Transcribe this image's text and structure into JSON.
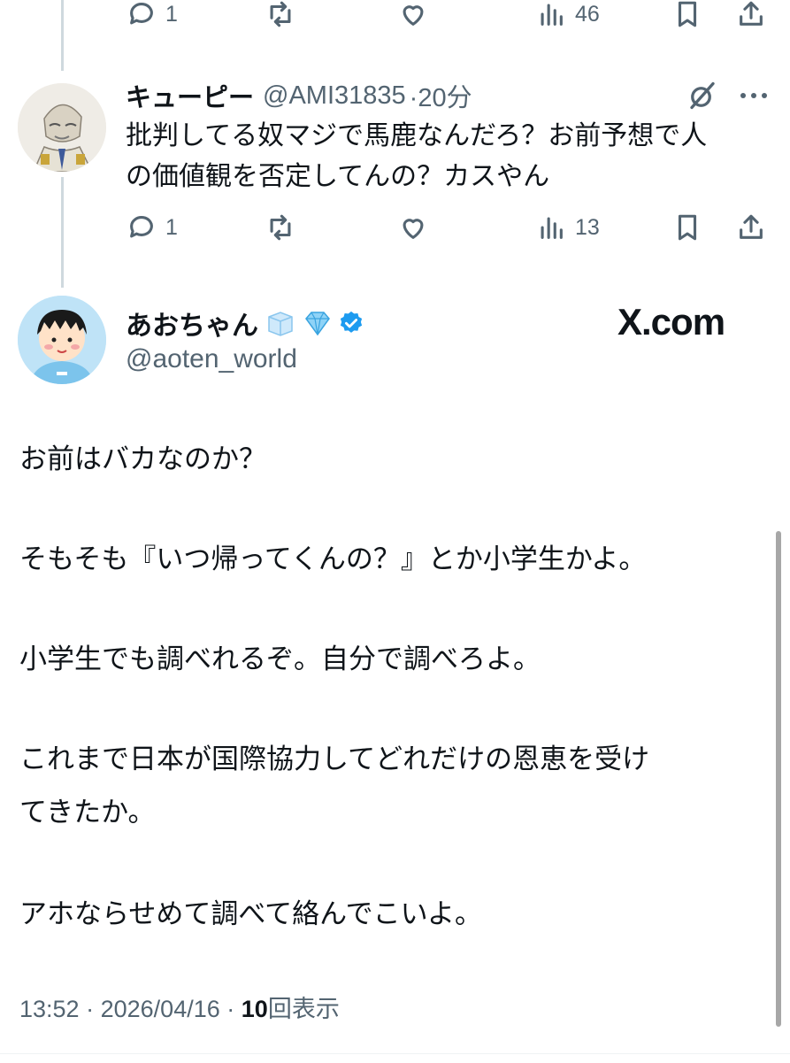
{
  "top_actions": {
    "reply_count": "1",
    "view_count": "46"
  },
  "reply": {
    "display_name": "キューピー",
    "handle": "@AMI31835",
    "time": "·20分",
    "text_line1": "批判してる奴マジで馬鹿なんだろ？お前予想で人",
    "text_line2": "の価値観を否定してんの？カスやん",
    "actions": {
      "reply_count": "1",
      "view_count": "13"
    }
  },
  "main": {
    "display_name": "あおちゃん",
    "name_icons": [
      "ice-cube-icon",
      "diamond-icon",
      "verified-badge-icon"
    ],
    "handle": "@aoten_world",
    "watermark": "X.com",
    "paragraphs": [
      "お前はバカなのか？",
      "そもそも『いつ帰ってくんの？』とか小学生かよ。",
      "小学生でも調べれるぞ。自分で調べろよ。",
      "これまで日本が国際協力してどれだけの恩恵を受け",
      "てきたか。",
      "アホならせめて調べて絡んでこいよ。"
    ],
    "footer": {
      "time": "13:52",
      "sep1": "·",
      "date": "2026/04/16",
      "sep2": "·",
      "views_number": "10",
      "views_label": "回表示"
    }
  },
  "colors": {
    "text": "#0f1419",
    "muted": "#536471",
    "verified": "#1d9bf0",
    "thread_line": "#cfd9de"
  }
}
